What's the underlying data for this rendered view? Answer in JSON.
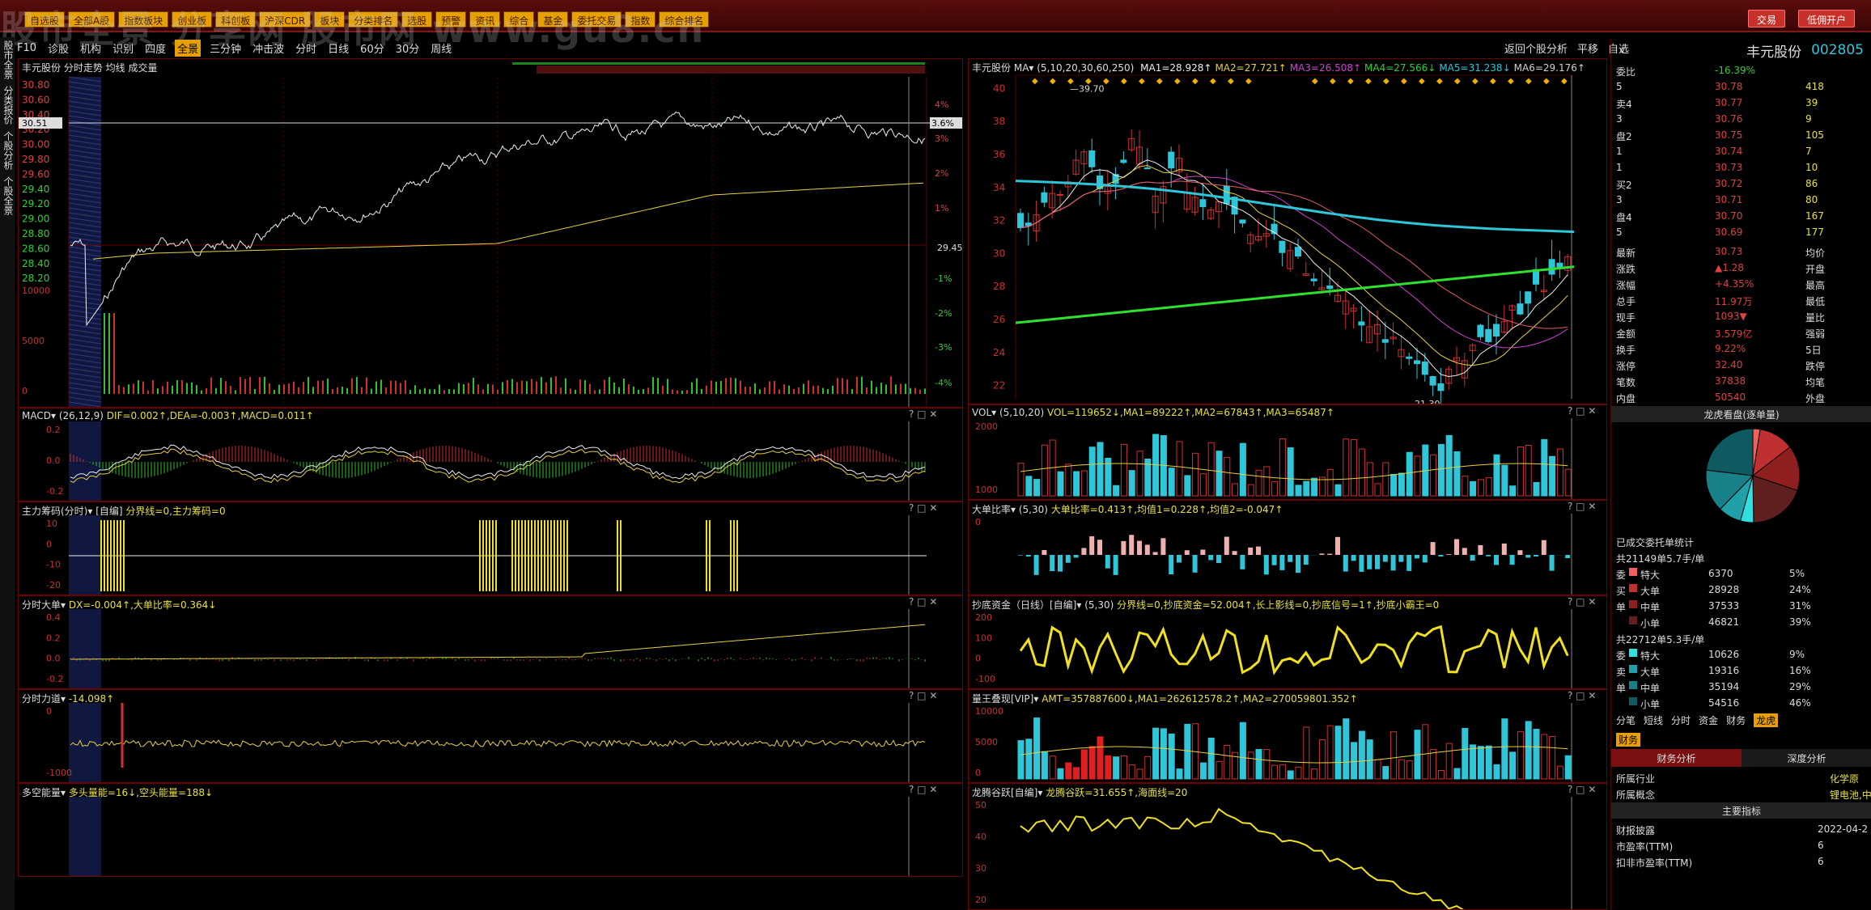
{
  "watermark": "股市全景 分享网 股市网 www.gu8.cn",
  "top_menu": [
    "自选股",
    "全部A股",
    "指数板块",
    "创业板",
    "科创板",
    "沪深CDR",
    "板块",
    "分类排名",
    "选股",
    "预警",
    "资讯",
    "综合",
    "基金",
    "委托交易",
    "指数",
    "综合排名"
  ],
  "top_buttons": {
    "trade": "交易",
    "open": "低佣开户"
  },
  "toolbar": {
    "items": [
      "F10",
      "诊股",
      "机构",
      "识别",
      "四度",
      "全景",
      "三分钟",
      "冲击波",
      "分时",
      "日线",
      "60分",
      "30分",
      "周线"
    ],
    "active": "全景",
    "right": [
      "返回个股分析",
      "平移",
      "自选"
    ]
  },
  "leftnav": [
    "股市全景",
    "分类报价",
    "个股分析",
    "个股全景"
  ],
  "intraday": {
    "title": "丰元股份 分时走势 均线 成交量",
    "price_ticks": [
      "30.80",
      "30.60",
      "30.40",
      "30.20",
      "30.00",
      "29.80",
      "29.60",
      "29.40",
      "29.20",
      "29.00",
      "28.80",
      "28.60",
      "28.40",
      "28.20"
    ],
    "pct_ticks": [
      "4%",
      "3%",
      "2%",
      "1%",
      "-1%",
      "-2%",
      "-3%",
      "-4%"
    ],
    "cursor_price": "30.51",
    "cursor_pct": "3.6%",
    "mid_label": "29.45",
    "vol_ticks": [
      "10000",
      "5000",
      "0"
    ]
  },
  "sub_left": [
    {
      "title": "MACD",
      "params": "(26,12,9)",
      "text": "DIF=0.002↑,DEA=-0.003↑,MACD=0.011↑",
      "ticks": [
        "0.2",
        "0.0",
        "-0.2"
      ]
    },
    {
      "title": "主力筹码(分时)",
      "params": "[自编]",
      "text": "分界线=0,主力筹码=0",
      "ticks": [
        "10",
        "0",
        "-10",
        "-20"
      ]
    },
    {
      "title": "分时大单",
      "params": "",
      "text": "DX=-0.004↑,大单比率=0.364↓",
      "ticks": [
        "0.4",
        "0.2",
        "0.0",
        "-0.2"
      ]
    },
    {
      "title": "分时力道",
      "params": "",
      "text": "-14.098↑",
      "ticks": [
        "0",
        "-1000"
      ]
    },
    {
      "title": "多空能量",
      "params": "",
      "text": "多头量能=16↓,空头能量=188↓",
      "ticks": []
    }
  ],
  "daily": {
    "title": "丰元股份",
    "ma_params": "(5,10,20,30,60,250)",
    "ma": [
      "MA1=28.928↑",
      "MA2=27.721↑",
      "MA3=26.508↑",
      "MA4=27.566↓",
      "MA5=31.238↓",
      "MA6=29.176↑"
    ],
    "ticks": [
      "40",
      "38",
      "36",
      "34",
      "32",
      "30",
      "28",
      "26",
      "24",
      "22"
    ],
    "high_label": "39.70",
    "low_label": "21.30"
  },
  "sub_right": [
    {
      "title": "VOL",
      "params": "(5,10,20)",
      "text": "VOL=119652↓,MA1=89222↑,MA2=67843↑,MA3=65487↑",
      "ticks": [
        "2000",
        "1000"
      ]
    },
    {
      "title": "大单比率",
      "params": "(5,30)",
      "text": "大单比率=0.413↑,均值1=0.228↑,均值2=-0.047↑",
      "ticks": [
        "0"
      ]
    },
    {
      "title": "抄底资金（日线）[自编]",
      "params": "(5,30)",
      "text": "分界线=0,抄底资金=52.004↑,长上影线=0,抄底信号=1↑,抄底小霸王=0",
      "ticks": [
        "200",
        "100",
        "0",
        "-100"
      ]
    },
    {
      "title": "量王叠现[VIP]",
      "params": "",
      "text": "AMT=357887600↓,MA1=262612578.2↑,MA2=270059801.352↑",
      "ticks": [
        "10000",
        "5000",
        "0"
      ]
    },
    {
      "title": "龙腾谷跃[自编]",
      "params": "",
      "text": "龙腾谷跃=31.655↑,海面线=20",
      "ticks": [
        "50",
        "40",
        "30",
        "20"
      ]
    }
  ],
  "quote": {
    "name": "丰元股份",
    "code": "002805",
    "weibi_label": "委比",
    "weibi": "-16.39%",
    "sell": [
      {
        "l": "5",
        "p": "30.78",
        "v": "418"
      },
      {
        "l": "卖4",
        "p": "30.77",
        "v": "39"
      },
      {
        "l": "3",
        "p": "30.76",
        "v": "9"
      },
      {
        "l": "盘2",
        "p": "30.75",
        "v": "105"
      },
      {
        "l": "1",
        "p": "30.74",
        "v": "7"
      }
    ],
    "buy": [
      {
        "l": "1",
        "p": "30.73",
        "v": "10"
      },
      {
        "l": "买2",
        "p": "30.72",
        "v": "86"
      },
      {
        "l": "3",
        "p": "30.71",
        "v": "80"
      },
      {
        "l": "盘4",
        "p": "30.70",
        "v": "167"
      },
      {
        "l": "5",
        "p": "30.69",
        "v": "177"
      }
    ],
    "stats": [
      {
        "k": "最新",
        "v": "30.73",
        "k2": "均价"
      },
      {
        "k": "涨跌",
        "v": "▲1.28",
        "k2": "开盘"
      },
      {
        "k": "涨幅",
        "v": "+4.35%",
        "k2": "最高"
      },
      {
        "k": "总手",
        "v": "11.97万",
        "k2": "最低"
      },
      {
        "k": "现手",
        "v": "1093▼",
        "k2": "量比"
      },
      {
        "k": "金额",
        "v": "3.579亿",
        "k2": "强弱"
      },
      {
        "k": "换手",
        "v": "9.22%",
        "k2": "5日"
      },
      {
        "k": "涨停",
        "v": "32.40",
        "k2": "跌停"
      },
      {
        "k": "笔数",
        "v": "37838",
        "k2": "均笔"
      },
      {
        "k": "内盘",
        "v": "50540",
        "k2": "外盘"
      }
    ],
    "pie_title": "龙虎看盘(逐单量)",
    "done_title": "已成交委托单统计",
    "buy_total": "共21149单5.7手/单",
    "buy_rows": [
      {
        "k": "特大",
        "v": "6370",
        "p": "5%"
      },
      {
        "k": "大单",
        "v": "28928",
        "p": "24%"
      },
      {
        "k": "中单",
        "v": "37533",
        "p": "31%"
      },
      {
        "k": "小单",
        "v": "46821",
        "p": "39%"
      }
    ],
    "buy_side": [
      "委",
      "买",
      "单"
    ],
    "sell_total": "共22712单5.3手/单",
    "sell_rows": [
      {
        "k": "特大",
        "v": "10626",
        "p": "9%"
      },
      {
        "k": "大单",
        "v": "19316",
        "p": "16%"
      },
      {
        "k": "中单",
        "v": "35194",
        "p": "29%"
      },
      {
        "k": "小单",
        "v": "54516",
        "p": "46%"
      }
    ],
    "sell_side": [
      "委",
      "卖",
      "单"
    ],
    "tabs": [
      "分笔",
      "短线",
      "分时",
      "资金",
      "财务",
      "龙虎"
    ],
    "tab_active": "龙虎",
    "fin_tag": "财务",
    "fin_tabs": [
      "财务分析",
      "深度分析"
    ],
    "industry_k": "所属行业",
    "industry_v": "化学原",
    "concept_k": "所属概念",
    "concept_v": "锂电池,中",
    "main_index": "主要指标",
    "f_rows": [
      {
        "k": "财报披露",
        "v": "2022-04-2"
      },
      {
        "k": "市盈率(TTM)",
        "v": "6"
      },
      {
        "k": "扣非市盈率(TTM)",
        "v": "6"
      }
    ]
  }
}
